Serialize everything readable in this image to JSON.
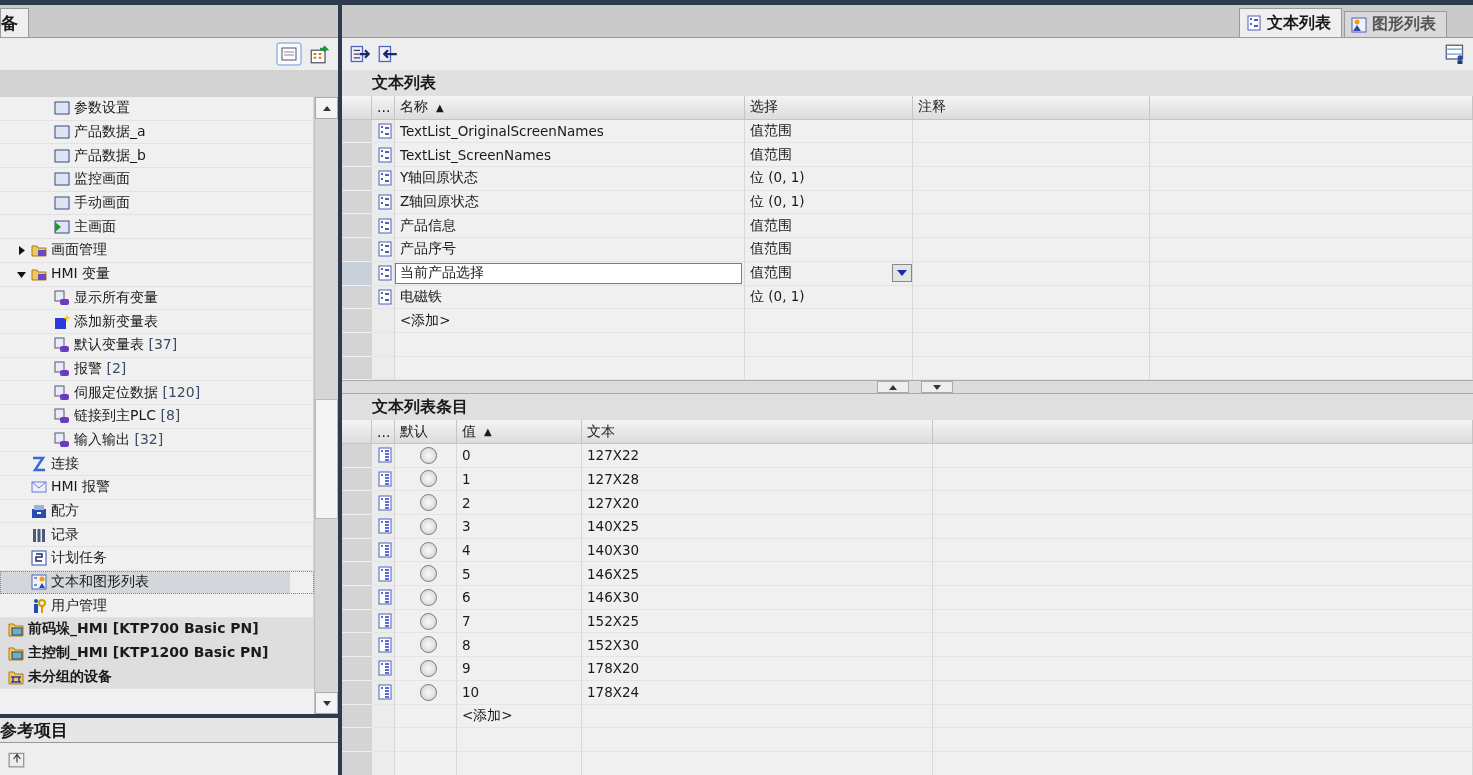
{
  "left_panel": {
    "tab": "备",
    "tree": [
      {
        "children": [
          {
            "children": [
              {
                "label": "参数设置",
                "kind": "screen",
                "selected": false
              },
              {
                "label": "产品数据_a",
                "kind": "screen",
                "selected": false
              },
              {
                "label": "产品数据_b",
                "kind": "screen",
                "selected": false
              },
              {
                "label": "监控画面",
                "kind": "screen",
                "selected": false
              },
              {
                "label": "手动画面",
                "kind": "screen",
                "selected": false
              },
              {
                "label": "主画面",
                "kind": "start-screen",
                "selected": false
              }
            ]
          },
          {
            "label": "画面管理",
            "kind": "folder",
            "expanded": false,
            "selected": false
          },
          {
            "label": "HMI 变量",
            "kind": "folder",
            "expanded": true,
            "selected": false,
            "children": [
              {
                "label": "显示所有变量",
                "kind": "tags",
                "selected": false
              },
              {
                "label": "添加新变量表",
                "kind": "add",
                "selected": false
              },
              {
                "label": "默认变量表",
                "count": "[37]",
                "kind": "tags",
                "selected": false
              },
              {
                "label": "报警",
                "count": "[2]",
                "kind": "tags",
                "selected": false
              },
              {
                "label": "伺服定位数据",
                "count": "[120]",
                "kind": "tags",
                "selected": false
              },
              {
                "label": "链接到主PLC",
                "count": "[8]",
                "kind": "tags",
                "selected": false
              },
              {
                "label": "输入输出",
                "count": "[32]",
                "kind": "tags",
                "selected": false
              }
            ]
          },
          {
            "label": "连接",
            "kind": "connection",
            "selected": false
          },
          {
            "label": "HMI 报警",
            "kind": "alarm",
            "selected": false
          },
          {
            "label": "配方",
            "kind": "recipe",
            "selected": false
          },
          {
            "label": "记录",
            "kind": "log",
            "selected": false
          },
          {
            "label": "计划任务",
            "kind": "schedule",
            "selected": false
          },
          {
            "label": "文本和图形列表",
            "kind": "textlist",
            "selected": true
          },
          {
            "label": "用户管理",
            "kind": "users",
            "selected": false
          }
        ]
      },
      {
        "label": "前码垛_HMI [KTP700 Basic PN]",
        "kind": "device",
        "selected": false
      },
      {
        "label": "主控制_HMI [KTP1200 Basic PN]",
        "kind": "device",
        "selected": false
      },
      {
        "label": "未分组的设备",
        "kind": "ungrouped",
        "selected": false
      }
    ],
    "reference_title": "参考项目"
  },
  "editor_tabs": [
    {
      "label": "文本列表",
      "kind": "textlist",
      "selected": true
    },
    {
      "label": "图形列表",
      "kind": "graphic",
      "selected": false
    }
  ],
  "text_lists": {
    "title": "文本列表",
    "columns": [
      {
        "label": "..."
      },
      {
        "label": "名称",
        "sort": "▲"
      },
      {
        "label": "选择"
      },
      {
        "label": "注释"
      }
    ],
    "rows": [
      {
        "name": "TextList_OriginalScreenNames",
        "selection": "值范围",
        "editing": false
      },
      {
        "name": "TextList_ScreenNames",
        "selection": "值范围",
        "editing": false
      },
      {
        "name": "Y轴回原状态",
        "selection": "位 (0, 1)",
        "editing": false
      },
      {
        "name": "Z轴回原状态",
        "selection": "位 (0, 1)",
        "editing": false
      },
      {
        "name": "产品信息",
        "selection": "值范围",
        "editing": false
      },
      {
        "name": "产品序号",
        "selection": "值范围",
        "editing": false
      },
      {
        "name": "当前产品选择",
        "selection": "值范围",
        "editing": true
      },
      {
        "name": "电磁铁",
        "selection": "位 (0, 1)",
        "editing": false
      }
    ],
    "add_label": "<添加>"
  },
  "entries": {
    "title": "文本列表条目",
    "columns": [
      {
        "label": "..."
      },
      {
        "label": "默认"
      },
      {
        "label": "值",
        "sort": "▲"
      },
      {
        "label": "文本"
      }
    ],
    "rows": [
      {
        "default": false,
        "value": "0",
        "text": "127X22"
      },
      {
        "default": false,
        "value": "1",
        "text": "127X28"
      },
      {
        "default": false,
        "value": "2",
        "text": "127X20"
      },
      {
        "default": false,
        "value": "3",
        "text": "140X25"
      },
      {
        "default": false,
        "value": "4",
        "text": "140X30"
      },
      {
        "default": false,
        "value": "5",
        "text": "146X25"
      },
      {
        "default": false,
        "value": "6",
        "text": "146X30"
      },
      {
        "default": false,
        "value": "7",
        "text": "152X25"
      },
      {
        "default": false,
        "value": "8",
        "text": "152X30"
      },
      {
        "default": false,
        "value": "9",
        "text": "178X20"
      },
      {
        "default": false,
        "value": "10",
        "text": "178X24"
      }
    ],
    "add_label": "<添加>"
  }
}
